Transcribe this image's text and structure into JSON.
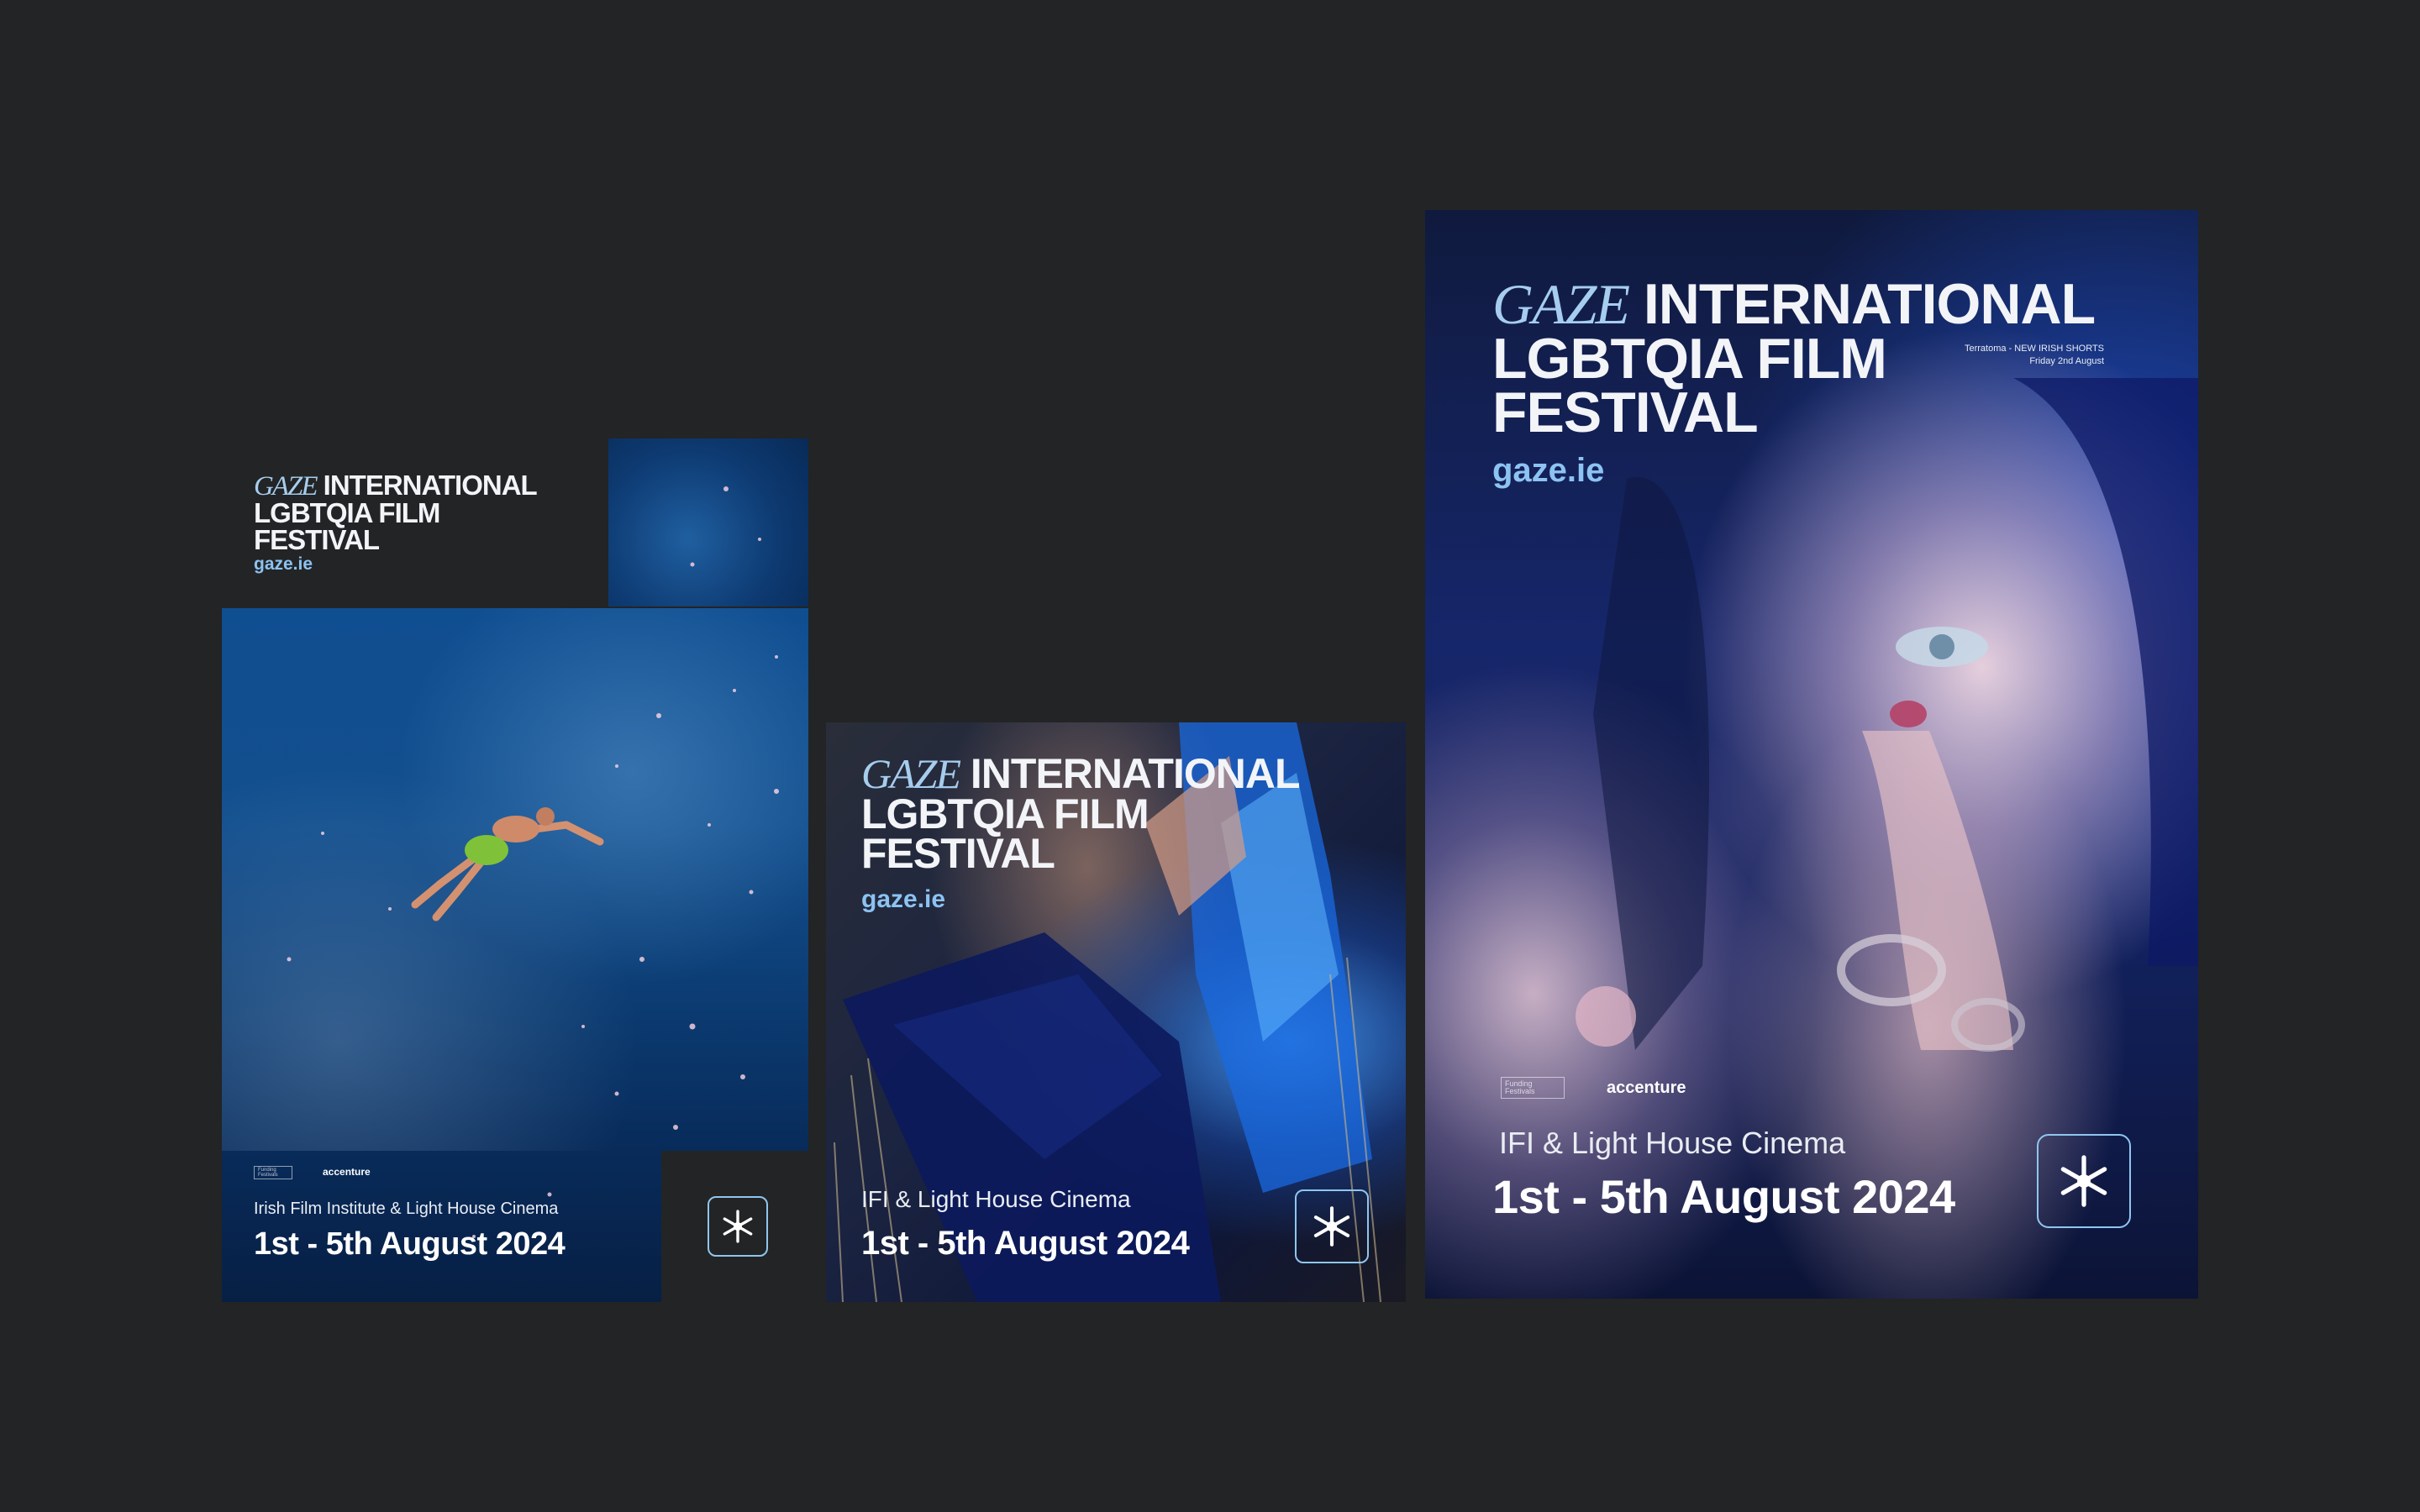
{
  "posters": {
    "tall": {
      "gaze": "GAZE",
      "title_line1": "INTERNATIONAL",
      "title_line2": "LGBTQIA FILM",
      "title_line3": "FESTIVAL",
      "url": "gaze.ie",
      "venue": "Irish Film Institute & Light House Cinema",
      "date": "1st - 5th August 2024",
      "sponsor_left": "Funding Festivals",
      "sponsor_right": "accenture",
      "logo_icon": "asterisk-logo-icon"
    },
    "square": {
      "gaze": "GAZE",
      "title_line1": "INTERNATIONAL",
      "title_line2": "LGBTQIA FILM",
      "title_line3": "FESTIVAL",
      "url": "gaze.ie",
      "venue": "IFI & Light House Cinema",
      "date": "1st - 5th August 2024",
      "logo_icon": "asterisk-logo-icon"
    },
    "large": {
      "gaze": "GAZE",
      "title_line1": "INTERNATIONAL",
      "title_line2": "LGBTQIA FILM",
      "title_line3": "FESTIVAL",
      "url": "gaze.ie",
      "screening_line1": "Terratoma - NEW IRISH SHORTS",
      "screening_line2": "Friday 2nd August",
      "venue": "IFI & Light House Cinema",
      "date": "1st - 5th August 2024",
      "sponsor_left": "Funding Festivals",
      "sponsor_right": "accenture",
      "logo_icon": "asterisk-logo-icon"
    }
  },
  "colors": {
    "background": "#232425",
    "accent": "#8cc3f2",
    "poster_navy": "#141c3c"
  }
}
